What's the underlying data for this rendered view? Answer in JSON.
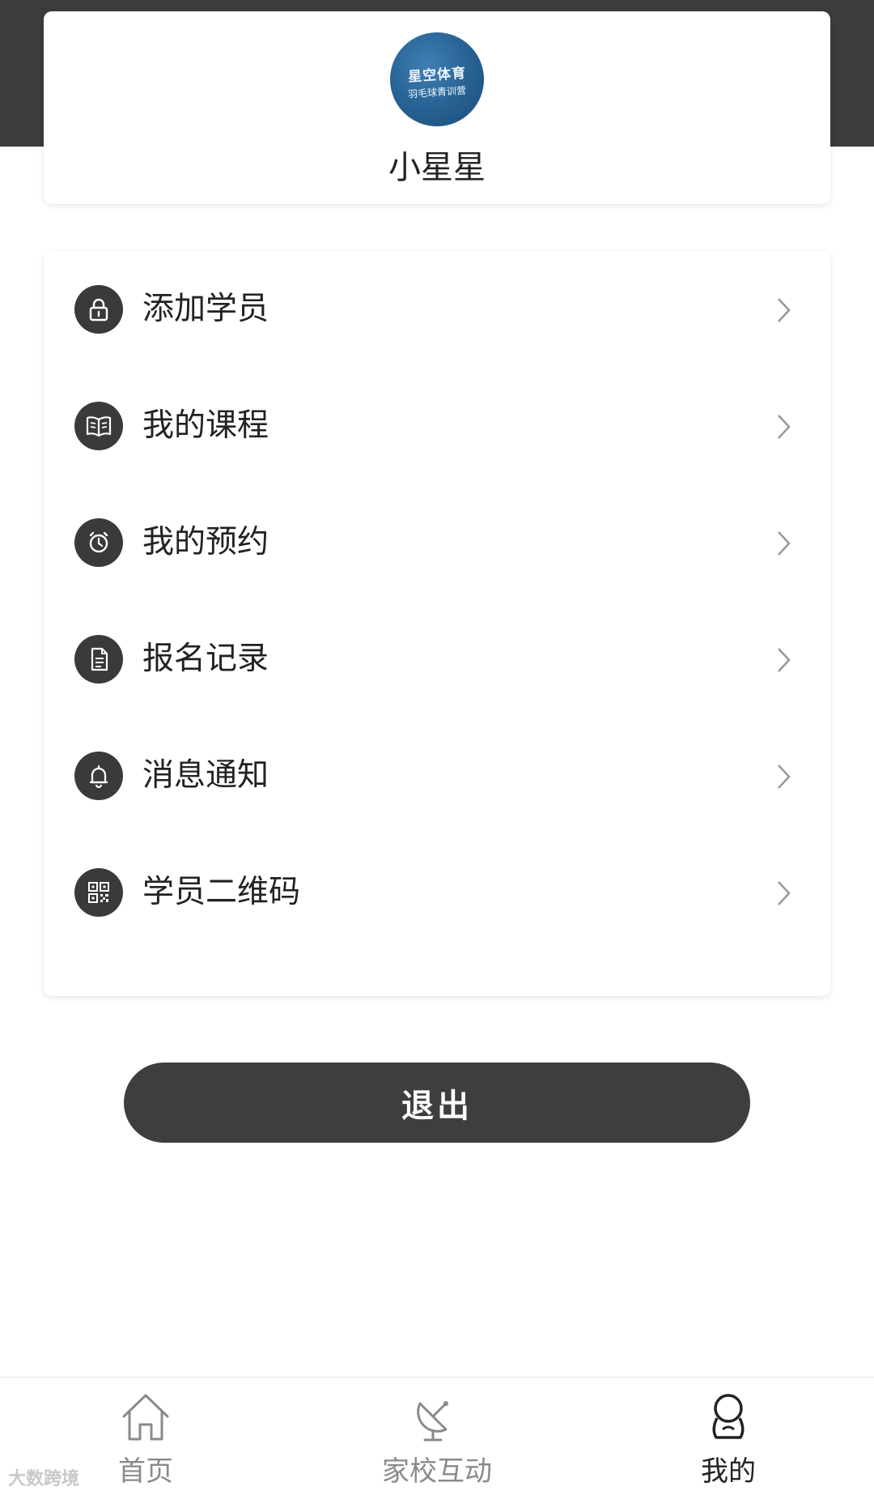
{
  "profile": {
    "avatar_text_line1": "星空体育",
    "avatar_text_line2": "羽毛球青训营",
    "name": "小星星"
  },
  "menu": {
    "items": [
      {
        "label": "添加学员",
        "icon": "lock-icon"
      },
      {
        "label": "我的课程",
        "icon": "book-icon"
      },
      {
        "label": "我的预约",
        "icon": "alarm-clock-icon"
      },
      {
        "label": "报名记录",
        "icon": "document-icon"
      },
      {
        "label": "消息通知",
        "icon": "bell-icon"
      },
      {
        "label": "学员二维码",
        "icon": "qr-code-icon"
      }
    ]
  },
  "logout_label": "退出",
  "tabbar": {
    "tabs": [
      {
        "label": "首页",
        "icon": "home-icon",
        "active": false
      },
      {
        "label": "家校互动",
        "icon": "satellite-dish-icon",
        "active": false
      },
      {
        "label": "我的",
        "icon": "user-icon",
        "active": true
      }
    ]
  },
  "watermark": "大数跨境",
  "colors": {
    "header_band": "#3c3c3c",
    "icon_circle": "#3a3a3a",
    "button": "#3e3e3e",
    "active_tab": "#222222",
    "inactive_tab": "#8a8a8a"
  }
}
